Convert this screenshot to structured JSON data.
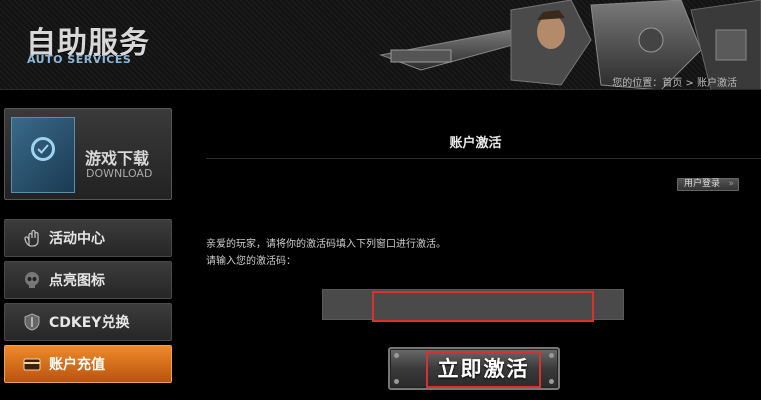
{
  "header": {
    "logo_cn": "自助服务",
    "logo_en": "AUTO SERVICES",
    "breadcrumb": "您的位置：首页 > 账户激活"
  },
  "sidebar": {
    "download": {
      "label_cn": "游戏下载",
      "label_en": "DOWNLOAD"
    },
    "items": [
      {
        "label": "活动中心",
        "icon": "hand-icon"
      },
      {
        "label": "点亮图标",
        "icon": "skull-icon"
      },
      {
        "label": "CDKEY兑换",
        "icon": "shield-icon"
      },
      {
        "label": "账户充值",
        "icon": "card-icon",
        "active": true
      }
    ]
  },
  "main": {
    "title": "账户激活",
    "login_button": "用户登录",
    "intro_line1": "亲爱的玩家，请将你的激活码填入下列窗口进行激活。",
    "intro_line2": "请输入您的激活码：",
    "code_input": {
      "value": "",
      "placeholder": ""
    },
    "activate_button": "立即激活"
  },
  "colors": {
    "accent_orange": "#e0701c",
    "highlight_red": "#d9322e",
    "background": "#000000"
  }
}
